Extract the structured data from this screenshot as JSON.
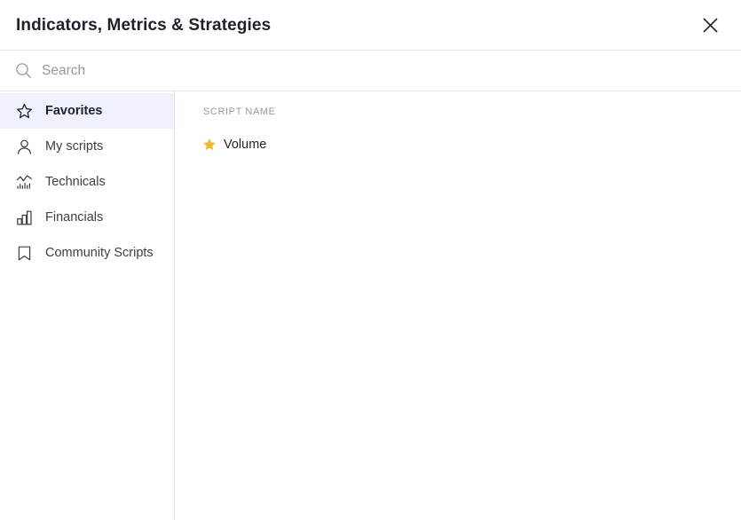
{
  "header": {
    "title": "Indicators, Metrics & Strategies",
    "close_icon": "close-icon"
  },
  "search": {
    "placeholder": "Search",
    "value": "",
    "icon": "search-icon"
  },
  "sidebar": {
    "items": [
      {
        "label": "Favorites",
        "icon": "star-outline-icon",
        "active": true
      },
      {
        "label": "My scripts",
        "icon": "person-icon",
        "active": false
      },
      {
        "label": "Technicals",
        "icon": "indicator-chart-icon",
        "active": false
      },
      {
        "label": "Financials",
        "icon": "bar-chart-icon",
        "active": false
      },
      {
        "label": "Community Scripts",
        "icon": "bookmark-icon",
        "active": false
      }
    ]
  },
  "content": {
    "column_header": "Script name",
    "rows": [
      {
        "name": "Volume",
        "favorite": true,
        "icon": "star-filled-icon"
      }
    ]
  },
  "colors": {
    "accent_highlight": "#eff2fa",
    "star_gold": "#f7b733",
    "border": "#e0e3eb",
    "text_primary": "#1e222d",
    "text_muted": "#9598a1"
  }
}
